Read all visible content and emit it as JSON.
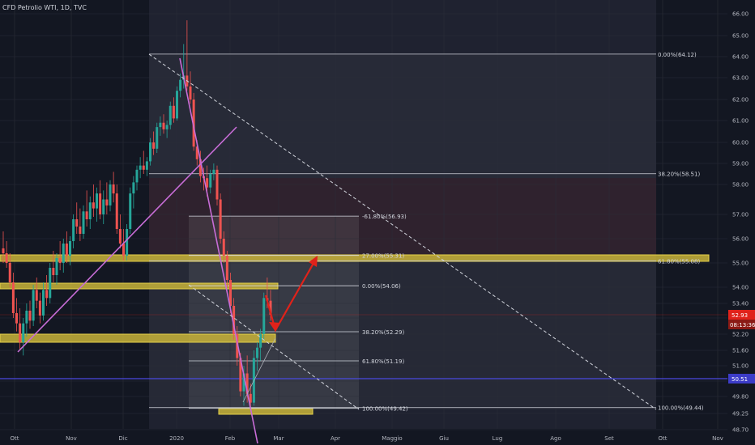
{
  "header": {
    "symbol_title": "CFD Petrolio WTI, 1D, TVC"
  },
  "colors": {
    "background": "#131722",
    "up_candle": "#26a69a",
    "down_candle": "#ef5350",
    "zone_fill": "#c9b43a",
    "fib_line": "#d1d4dc",
    "trend_line": "#c86dd7",
    "arrow": "#e0221a",
    "last_price_tag": "#e0221a",
    "blue_line": "#4a4ae0"
  },
  "chart_data": {
    "type": "candlestick",
    "title": "CFD Petrolio WTI, 1D, TVC",
    "ylim": [
      48.7,
      66.3
    ],
    "x_ticks": [
      "Ott",
      "Nov",
      "Dic",
      "2020",
      "Feb",
      "Mar",
      "Apr",
      "Maggio",
      "Giu",
      "Lug",
      "Ago",
      "Set",
      "Ott",
      "Nov"
    ],
    "y_ticks": [
      "66.00",
      "65.00",
      "64.00",
      "63.00",
      "62.00",
      "61.00",
      "60.00",
      "59.00",
      "58.00",
      "57.00",
      "56.00",
      "55.00",
      "54.00",
      "53.40",
      "52.80",
      "52.20",
      "51.60",
      "51.00",
      "50.40",
      "49.80",
      "49.25",
      "48.70"
    ],
    "last_price": "52.93",
    "countdown": "08:13:36",
    "blue_line_value": "50.51",
    "fib_outer": [
      {
        "label": "0.00%(64.12)",
        "value": 64.12
      },
      {
        "label": "38.20%(58.51)",
        "value": 58.51
      },
      {
        "label": "61.80%(55.08)",
        "value": 55.08
      },
      {
        "label": "100.00%(49.44)",
        "value": 49.44
      }
    ],
    "fib_inner": [
      {
        "label": "-61.80%(56.93)",
        "value": 56.93
      },
      {
        "label": "27.00%(55.31)",
        "value": 55.31
      },
      {
        "label": "0.00%(54.06)",
        "value": 54.06
      },
      {
        "label": "38.20%(52.29)",
        "value": 52.29
      },
      {
        "label": "61.80%(51.19)",
        "value": 51.19
      },
      {
        "label": "100.00%(49.42)",
        "value": 49.42
      }
    ],
    "candles": [
      {
        "o": 55.6,
        "h": 56.3,
        "l": 55.0,
        "c": 55.4
      },
      {
        "o": 55.4,
        "h": 55.9,
        "l": 54.8,
        "c": 55.0
      },
      {
        "o": 55.0,
        "h": 55.4,
        "l": 54.0,
        "c": 54.2
      },
      {
        "o": 54.2,
        "h": 54.6,
        "l": 52.8,
        "c": 53.0
      },
      {
        "o": 53.0,
        "h": 53.6,
        "l": 52.3,
        "c": 52.6
      },
      {
        "o": 52.6,
        "h": 53.2,
        "l": 51.6,
        "c": 51.9
      },
      {
        "o": 51.9,
        "h": 52.8,
        "l": 51.4,
        "c": 52.6
      },
      {
        "o": 52.6,
        "h": 53.4,
        "l": 52.1,
        "c": 53.1
      },
      {
        "o": 53.1,
        "h": 53.5,
        "l": 52.4,
        "c": 52.7
      },
      {
        "o": 52.7,
        "h": 54.1,
        "l": 52.5,
        "c": 53.9
      },
      {
        "o": 53.9,
        "h": 54.4,
        "l": 53.2,
        "c": 53.5
      },
      {
        "o": 53.5,
        "h": 53.8,
        "l": 52.6,
        "c": 52.9
      },
      {
        "o": 52.9,
        "h": 54.2,
        "l": 52.7,
        "c": 53.9
      },
      {
        "o": 53.9,
        "h": 54.5,
        "l": 53.3,
        "c": 53.6
      },
      {
        "o": 53.6,
        "h": 55.0,
        "l": 53.4,
        "c": 54.8
      },
      {
        "o": 54.8,
        "h": 55.5,
        "l": 54.2,
        "c": 54.5
      },
      {
        "o": 54.5,
        "h": 55.4,
        "l": 54.1,
        "c": 55.2
      },
      {
        "o": 55.2,
        "h": 55.9,
        "l": 54.7,
        "c": 55.0
      },
      {
        "o": 55.0,
        "h": 56.0,
        "l": 54.6,
        "c": 55.8
      },
      {
        "o": 55.8,
        "h": 56.3,
        "l": 55.0,
        "c": 55.3
      },
      {
        "o": 55.3,
        "h": 56.1,
        "l": 54.9,
        "c": 55.9
      },
      {
        "o": 55.9,
        "h": 57.0,
        "l": 55.6,
        "c": 56.8
      },
      {
        "o": 56.8,
        "h": 57.4,
        "l": 56.2,
        "c": 56.5
      },
      {
        "o": 56.5,
        "h": 57.2,
        "l": 55.9,
        "c": 56.2
      },
      {
        "o": 56.2,
        "h": 57.3,
        "l": 56.0,
        "c": 57.1
      },
      {
        "o": 57.1,
        "h": 57.8,
        "l": 56.5,
        "c": 56.8
      },
      {
        "o": 56.8,
        "h": 57.6,
        "l": 56.4,
        "c": 57.4
      },
      {
        "o": 57.4,
        "h": 58.0,
        "l": 56.9,
        "c": 57.2
      },
      {
        "o": 57.2,
        "h": 57.9,
        "l": 56.7,
        "c": 57.7
      },
      {
        "o": 57.7,
        "h": 58.2,
        "l": 56.8,
        "c": 57.0
      },
      {
        "o": 57.0,
        "h": 57.8,
        "l": 56.6,
        "c": 57.5
      },
      {
        "o": 57.5,
        "h": 58.1,
        "l": 57.0,
        "c": 57.3
      },
      {
        "o": 57.3,
        "h": 58.2,
        "l": 57.1,
        "c": 58.0
      },
      {
        "o": 58.0,
        "h": 58.6,
        "l": 57.4,
        "c": 57.7
      },
      {
        "o": 57.7,
        "h": 58.0,
        "l": 56.2,
        "c": 56.4
      },
      {
        "o": 56.4,
        "h": 57.0,
        "l": 55.6,
        "c": 55.8
      },
      {
        "o": 55.8,
        "h": 56.4,
        "l": 55.1,
        "c": 55.3
      },
      {
        "o": 55.3,
        "h": 56.6,
        "l": 55.1,
        "c": 56.4
      },
      {
        "o": 56.4,
        "h": 57.9,
        "l": 56.2,
        "c": 57.7
      },
      {
        "o": 57.7,
        "h": 58.4,
        "l": 57.2,
        "c": 58.1
      },
      {
        "o": 58.1,
        "h": 58.9,
        "l": 57.8,
        "c": 58.7
      },
      {
        "o": 58.7,
        "h": 59.3,
        "l": 58.3,
        "c": 58.9
      },
      {
        "o": 58.9,
        "h": 59.6,
        "l": 58.5,
        "c": 58.7
      },
      {
        "o": 58.7,
        "h": 59.3,
        "l": 58.4,
        "c": 59.1
      },
      {
        "o": 59.1,
        "h": 60.2,
        "l": 58.9,
        "c": 60.0
      },
      {
        "o": 60.0,
        "h": 60.5,
        "l": 59.4,
        "c": 59.7
      },
      {
        "o": 59.7,
        "h": 60.9,
        "l": 59.5,
        "c": 60.7
      },
      {
        "o": 60.7,
        "h": 61.2,
        "l": 60.3,
        "c": 60.9
      },
      {
        "o": 60.9,
        "h": 61.3,
        "l": 60.4,
        "c": 60.6
      },
      {
        "o": 60.6,
        "h": 61.0,
        "l": 60.2,
        "c": 60.8
      },
      {
        "o": 60.8,
        "h": 61.9,
        "l": 60.6,
        "c": 61.7
      },
      {
        "o": 61.7,
        "h": 62.1,
        "l": 60.9,
        "c": 61.1
      },
      {
        "o": 61.1,
        "h": 62.6,
        "l": 61.0,
        "c": 62.4
      },
      {
        "o": 62.4,
        "h": 63.2,
        "l": 62.1,
        "c": 62.9
      },
      {
        "o": 62.9,
        "h": 64.6,
        "l": 62.5,
        "c": 63.1
      },
      {
        "o": 63.1,
        "h": 65.7,
        "l": 62.4,
        "c": 62.6
      },
      {
        "o": 62.6,
        "h": 63.3,
        "l": 61.8,
        "c": 62.0
      },
      {
        "o": 62.0,
        "h": 62.3,
        "l": 59.6,
        "c": 59.8
      },
      {
        "o": 59.8,
        "h": 60.1,
        "l": 58.9,
        "c": 59.2
      },
      {
        "o": 59.2,
        "h": 59.6,
        "l": 58.1,
        "c": 58.4
      },
      {
        "o": 58.4,
        "h": 58.8,
        "l": 57.8,
        "c": 58.3
      },
      {
        "o": 58.3,
        "h": 58.9,
        "l": 57.6,
        "c": 57.9
      },
      {
        "o": 57.9,
        "h": 58.7,
        "l": 57.7,
        "c": 58.5
      },
      {
        "o": 58.5,
        "h": 59.0,
        "l": 58.2,
        "c": 58.7
      },
      {
        "o": 58.7,
        "h": 58.9,
        "l": 57.3,
        "c": 57.5
      },
      {
        "o": 57.5,
        "h": 57.7,
        "l": 55.8,
        "c": 56.0
      },
      {
        "o": 56.0,
        "h": 56.3,
        "l": 55.0,
        "c": 55.3
      },
      {
        "o": 55.3,
        "h": 55.5,
        "l": 54.0,
        "c": 54.3
      },
      {
        "o": 54.3,
        "h": 54.6,
        "l": 53.0,
        "c": 53.3
      },
      {
        "o": 53.3,
        "h": 53.6,
        "l": 52.0,
        "c": 52.2
      },
      {
        "o": 52.2,
        "h": 52.5,
        "l": 51.0,
        "c": 51.3
      },
      {
        "o": 51.3,
        "h": 51.5,
        "l": 49.8,
        "c": 50.0
      },
      {
        "o": 50.0,
        "h": 51.0,
        "l": 49.5,
        "c": 50.7
      },
      {
        "o": 50.7,
        "h": 51.4,
        "l": 49.6,
        "c": 49.9
      },
      {
        "o": 49.9,
        "h": 50.3,
        "l": 49.4,
        "c": 49.6
      },
      {
        "o": 49.6,
        "h": 51.6,
        "l": 49.5,
        "c": 51.3
      },
      {
        "o": 51.3,
        "h": 51.9,
        "l": 50.8,
        "c": 51.7
      },
      {
        "o": 51.7,
        "h": 52.4,
        "l": 51.2,
        "c": 52.2
      },
      {
        "o": 52.2,
        "h": 53.8,
        "l": 52.0,
        "c": 53.6
      },
      {
        "o": 53.6,
        "h": 54.4,
        "l": 53.2,
        "c": 53.5
      },
      {
        "o": 53.5,
        "h": 53.9,
        "l": 52.7,
        "c": 52.93
      }
    ]
  }
}
